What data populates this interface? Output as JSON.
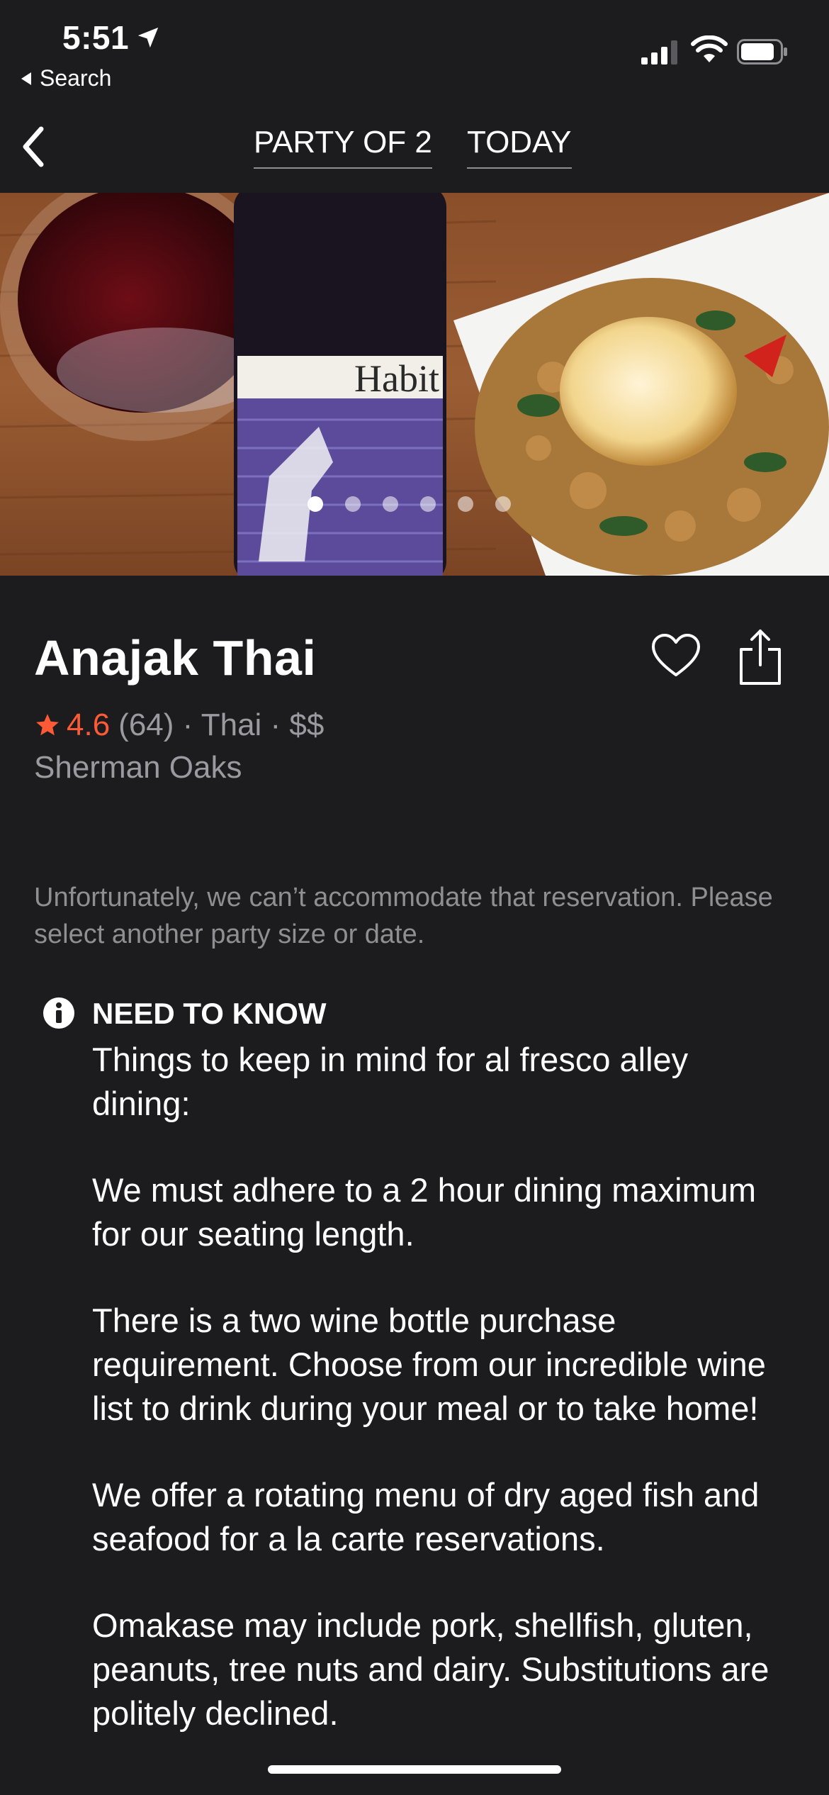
{
  "status_bar": {
    "time": "5:51",
    "back_app": "Search"
  },
  "nav": {
    "party": "PARTY OF 2",
    "date": "TODAY"
  },
  "hero": {
    "photo_count": 6,
    "active_index": 0,
    "label_text": "Habit"
  },
  "restaurant": {
    "name": "Anajak Thai",
    "rating": "4.6",
    "reviews": "(64) · Thai · $$",
    "neighborhood": "Sherman Oaks"
  },
  "availability_message": "Unfortunately, we can’t accommodate that reservation. Please select another party size or date.",
  "need_to_know": {
    "title": "NEED TO KNOW",
    "paragraphs": [
      "Things to keep in mind for al fresco alley dining:",
      "We must adhere to a 2 hour dining maximum for our seating length.",
      "There is a two wine bottle purchase requirement. Choose from our incredible wine list to drink during your meal or to take home!",
      "We offer a rotating menu of dry aged fish and seafood for a la carte reservations.",
      "Omakase may include pork, shellfish, gluten, peanuts, tree nuts and dairy. Substitutions are politely declined."
    ]
  },
  "colors": {
    "background": "#1c1c1e",
    "accent": "#ff5a36",
    "muted": "#9a9aa0"
  },
  "icons": [
    "location-arrow-icon",
    "signal-icon",
    "wifi-icon",
    "battery-icon",
    "back-chevron-icon",
    "heart-icon",
    "share-icon",
    "star-icon",
    "info-icon"
  ]
}
